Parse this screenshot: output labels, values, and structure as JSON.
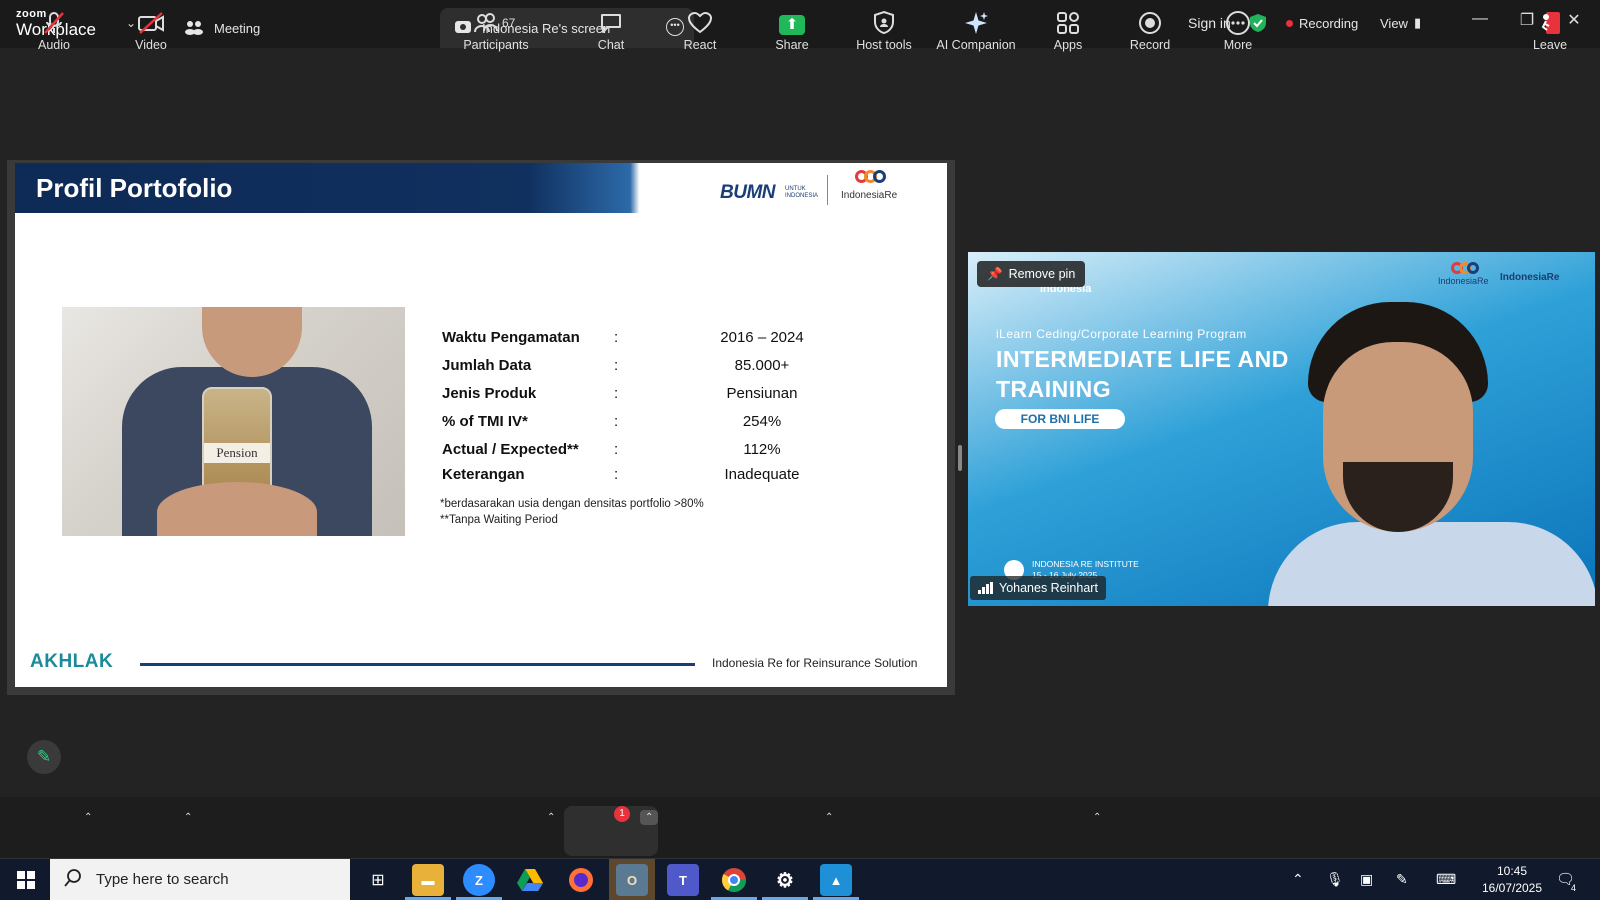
{
  "titlebar": {
    "brand_small": "zoom",
    "brand_big": "Workplace",
    "tab_meeting": "Meeting",
    "tab_screen": "Indonesia Re's screen",
    "sign_in": "Sign in",
    "recording": "Recording",
    "view": "View"
  },
  "slide": {
    "title": "Profil Portofolio",
    "bumn_logo": "BUMN",
    "bumn_sub": "UNTUK INDONESIA",
    "ire_logo": "IndonesiaRe",
    "image_label": "Pension",
    "rows": [
      {
        "key": "Waktu Pengamatan",
        "sep": ":",
        "value": "2016 – 2024"
      },
      {
        "key": "Jumlah Data",
        "sep": ":",
        "value": "85.000+"
      },
      {
        "key": "Jenis Produk",
        "sep": ":",
        "value": "Pensiunan"
      },
      {
        "key": "% of TMI IV*",
        "sep": ":",
        "value": "254%"
      },
      {
        "key": "Actual / Expected**",
        "sep": ":",
        "value": "112%"
      },
      {
        "key": "Keterangan",
        "sep": ":",
        "value": "Inadequate"
      }
    ],
    "note1": "*berdasarakan usia dengan densitas portfolio >80%",
    "note2": "**Tanpa Waiting Period",
    "footer_brand": "AKHLAK",
    "footer_text": "Indonesia Re for Reinsurance Solution"
  },
  "video": {
    "remove_pin": "Remove pin",
    "indonesia": "Indonesia",
    "program": "iLearn Ceding/Corporate Learning Program",
    "headline1": "INTERMEDIATE LIFE AND",
    "headline2": "TRAINING",
    "bni": "FOR BNI LIFE",
    "logo_ire": "IndonesiaRe",
    "logo_inst": "IndonesiaRe",
    "institute1": "INDONESIA RE INSTITUTE",
    "institute2": "15 - 16 July 2025",
    "participant_name": "Yohanes Reinhart"
  },
  "toolbar": {
    "audio": "Audio",
    "video": "Video",
    "participants": "Participants",
    "participants_count": "67",
    "chat": "Chat",
    "chat_badge": "1",
    "react": "React",
    "share": "Share",
    "host_tools": "Host tools",
    "ai_companion": "AI Companion",
    "apps": "Apps",
    "record": "Record",
    "more": "More",
    "leave": "Leave"
  },
  "taskbar": {
    "search_placeholder": "Type here to search",
    "time": "10:45",
    "date": "16/07/2025",
    "notif_count": "4"
  },
  "colors": {
    "slide_navy": "#0e2a56",
    "recording_red": "#e8323c",
    "share_green": "#20b859",
    "annotate_green": "#2bd08a"
  }
}
